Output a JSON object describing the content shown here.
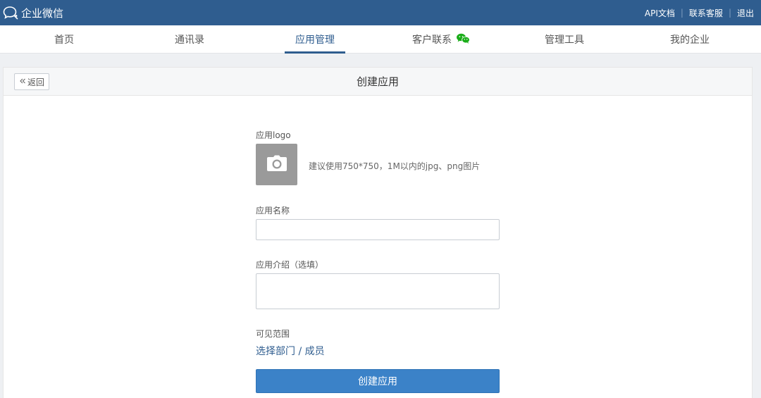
{
  "app": {
    "brand": "企业微信",
    "top_links": [
      "API文档",
      "联系客服",
      "退出"
    ]
  },
  "nav": {
    "tabs": [
      "首页",
      "通讯录",
      "应用管理",
      "客户联系",
      "管理工具",
      "我的企业"
    ],
    "active_index": 2
  },
  "panel": {
    "back_label": "返回",
    "title": "创建应用"
  },
  "form": {
    "logo_label": "应用logo",
    "logo_hint": "建议使用750*750，1M以内的jpg、png图片",
    "name_label": "应用名称",
    "name_value": "",
    "desc_label": "应用介绍（选填）",
    "desc_value": "",
    "scope_label": "可见范围",
    "scope_link": "选择部门 / 成员",
    "submit_label": "创建应用"
  },
  "colors": {
    "topbar": "#2f5d8f",
    "accent": "#3b82c8",
    "wechat_green": "#1aad19"
  },
  "icons": {
    "brand": "chat-bubble-icon",
    "back": "double-chevron-left-icon",
    "upload": "camera-icon",
    "customer_contact": "wechat-icon"
  }
}
